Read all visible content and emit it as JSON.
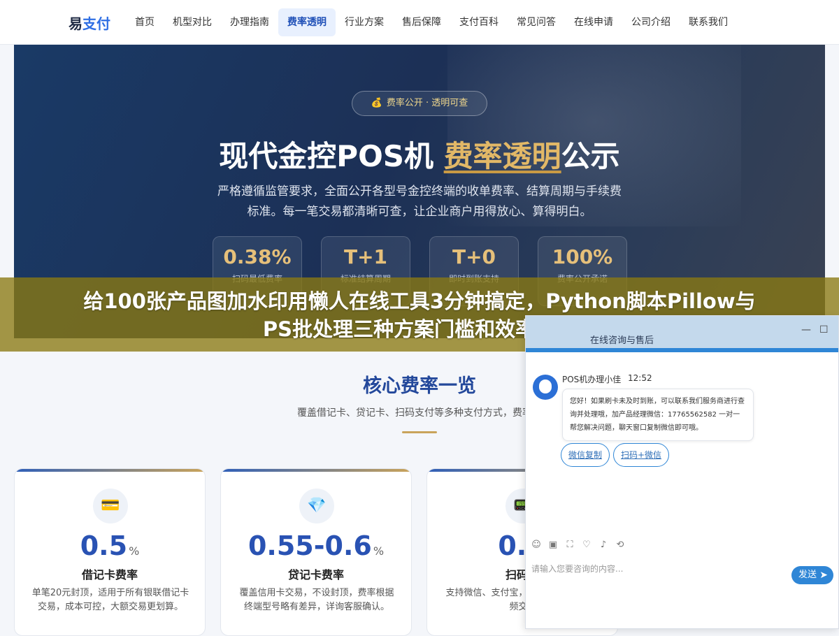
{
  "header": {
    "logo_part1": "易",
    "logo_part2": "支付",
    "nav": [
      "首页",
      "机型对比",
      "办理指南",
      "费率透明",
      "行业方案",
      "售后保障",
      "支付百科",
      "常见问答",
      "在线申请",
      "公司介绍",
      "联系我们"
    ],
    "active_index": 3
  },
  "hero": {
    "badge_icon": "money-bag-icon",
    "badge_text": "费率公开 · 透明可查",
    "title_pre": "现代金控POS机 ",
    "title_highlight": "费率透明",
    "title_post": "公示",
    "desc_line1": "严格遵循监管要求，全面公开各型号金控终端的收单费率、结算周期与手续费",
    "desc_line2": "标准。每一笔交易都清晰可查，让企业商户用得放心、算得明白。",
    "stats": [
      {
        "value": "0.38%",
        "label": "扫码最低费率"
      },
      {
        "value": "T+1",
        "label": "标准结算周期"
      },
      {
        "value": "T+0",
        "label": "即时到账支持"
      },
      {
        "value": "100%",
        "label": "费率公开承诺"
      }
    ]
  },
  "banner": {
    "line1": "给100张产品图加水印用懒人在线工具3分钟搞定，Python脚本Pillow与",
    "line2": "PS批处理三种方案门槛和效率对比"
  },
  "section": {
    "title": "核心费率一览",
    "subtitle": "覆盖借记卡、贷记卡、扫码支付等多种支付方式，费率标",
    "cards": [
      {
        "icon": "credit-card-icon",
        "number": "0.5",
        "unit": "%",
        "name": "借记卡费率",
        "desc": "单笔20元封顶，适用于所有银联借记卡交易，成本可控，大额交易更划算。"
      },
      {
        "icon": "diamond-icon",
        "number": "0.55-0.6",
        "unit": "%",
        "name": "贷记卡费率",
        "desc": "覆盖信用卡交易，不设封顶，费率根据终端型号略有差异，详询客服确认。"
      },
      {
        "icon": "qr-terminal-icon",
        "number": "0.3",
        "unit": "",
        "name": "扫码支",
        "desc": "支持微信、支付宝，流扫码方式，费率频交易"
      }
    ]
  },
  "chat": {
    "title": "在线咨询与售后",
    "minimize": "—",
    "maximize": "☐",
    "agent_name": "POS机办理小佳",
    "time": "12:52",
    "message": "您好！如果刷卡未及时到账，可以联系我们服务商进行查询并处理哦，加产品经理微信：17765562582 一对一帮您解决问题，聊天窗口复制微信即可哦。",
    "quick_buttons": [
      "微信复制",
      "扫码+微信"
    ],
    "tools": [
      "emoji-icon",
      "image-icon",
      "screenshot-icon",
      "rating-icon",
      "voice-icon",
      "switch-icon"
    ],
    "input_placeholder": "请输入您要咨询的内容...",
    "send_label": "发送",
    "send_icon": "send-arrow-icon"
  }
}
